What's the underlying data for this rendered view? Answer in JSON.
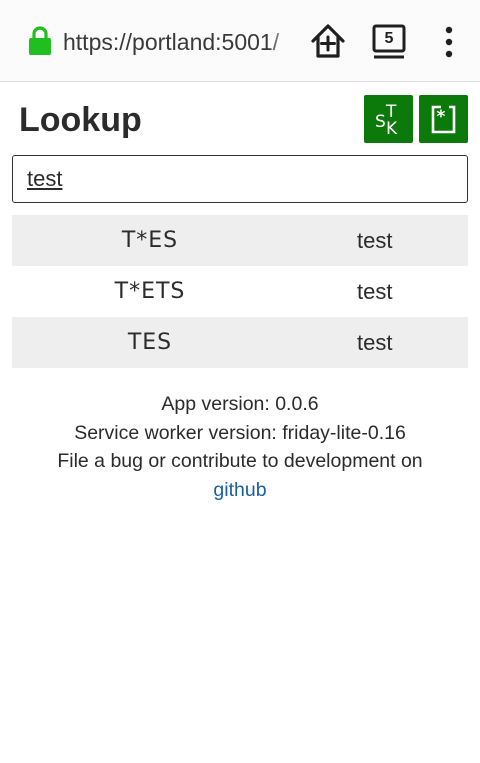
{
  "browser": {
    "url": "https://portland:5001/",
    "tab_count": "5"
  },
  "header": {
    "title": "Lookup"
  },
  "search": {
    "value": "test"
  },
  "results": [
    {
      "stroke": "T*ES",
      "translation": "test"
    },
    {
      "stroke": "T*ETS",
      "translation": "test"
    },
    {
      "stroke": "TES",
      "translation": "test"
    }
  ],
  "footer": {
    "app_version": "App version: 0.0.6",
    "sw_version": "Service worker version: friday-lite-0.16",
    "contribute": "File a bug or contribute to development on",
    "link": "github"
  },
  "colors": {
    "accent": "#0b7a0b",
    "lock": "#1fbf1f",
    "link": "#1a5fa0"
  }
}
